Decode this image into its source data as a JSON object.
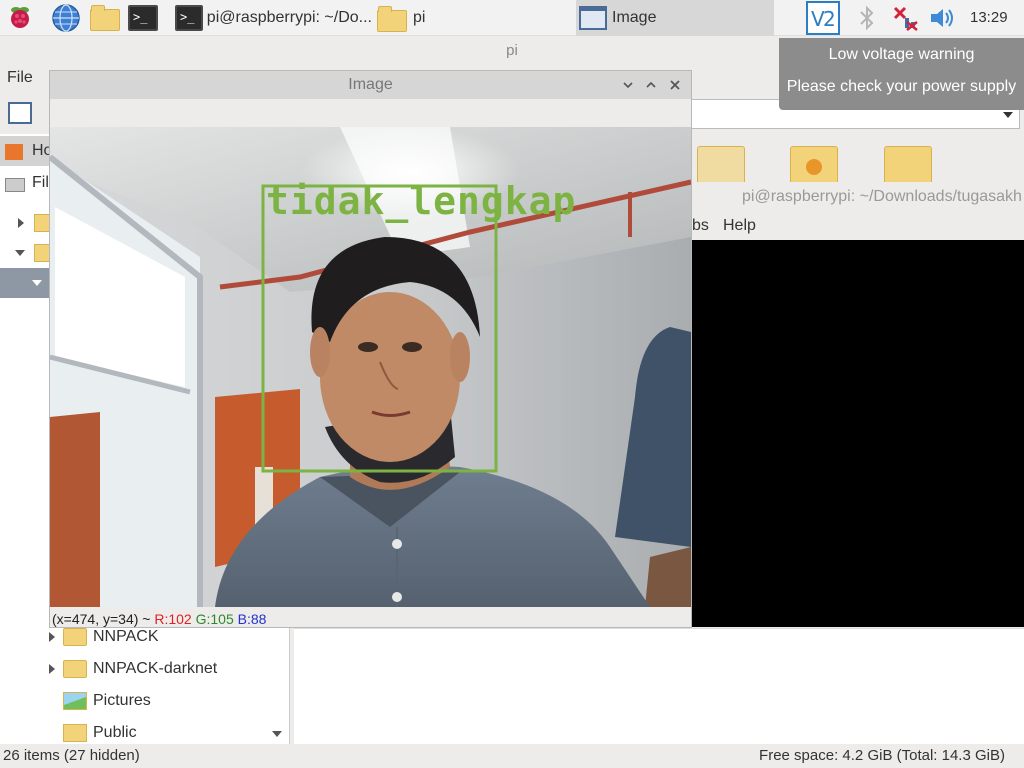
{
  "taskbar": {
    "tasks": [
      {
        "label": "pi@raspberrypi: ~/Do..."
      },
      {
        "label": "pi"
      },
      {
        "label": "Image"
      }
    ],
    "tray": {
      "vnc_icon": "vnc-icon",
      "bluetooth_icon": "bluetooth-icon",
      "network_icon": "network-disconnected-icon",
      "volume_icon": "volume-icon"
    },
    "clock": "13:29"
  },
  "tooltip": {
    "line1": "Low voltage warning",
    "line2": "Please check your power supply"
  },
  "file_manager": {
    "title": "pi",
    "menu_file": "File",
    "sidebar_partial": [
      "Ho",
      "Fil"
    ],
    "tree": [
      {
        "label": "NNPACK",
        "expandable": true,
        "icon": "folder"
      },
      {
        "label": "NNPACK-darknet",
        "expandable": true,
        "icon": "folder"
      },
      {
        "label": "Pictures",
        "expandable": false,
        "icon": "pictures"
      },
      {
        "label": "Public",
        "expandable": false,
        "icon": "public"
      }
    ],
    "status_left": "26 items (27 hidden)",
    "status_right": "Free space: 4.2 GiB (Total: 14.3 GiB)"
  },
  "terminal": {
    "title": "pi@raspberrypi: ~/Downloads/tugasakh",
    "menu_partial": "bs",
    "menu_help": "Help"
  },
  "image_window": {
    "title": "Image",
    "detection_label": "tidak_lengkap",
    "detection_color": "#7cb342",
    "readout_prefix": "(x=474, y=34) ~",
    "readout_r": "R:102",
    "readout_g": "G:105",
    "readout_b": "B:88"
  }
}
